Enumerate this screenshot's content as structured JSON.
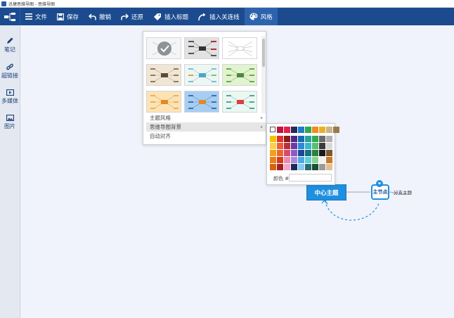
{
  "window": {
    "title": "迅捷思维导图 - 思维导图"
  },
  "toolbar": {
    "items": [
      {
        "label": "文件",
        "icon": "menu-icon"
      },
      {
        "label": "保存",
        "icon": "save-icon"
      },
      {
        "label": "撤销",
        "icon": "undo-icon"
      },
      {
        "label": "还原",
        "icon": "redo-icon"
      },
      {
        "label": "插入标题",
        "icon": "tag-icon"
      },
      {
        "label": "插入关连线",
        "icon": "relation-line-icon"
      },
      {
        "label": "风格",
        "icon": "palette-icon"
      }
    ],
    "active": "风格"
  },
  "sidebar": {
    "items": [
      {
        "label": "笔记",
        "icon": "pen-icon"
      },
      {
        "label": "超链接",
        "icon": "link-icon"
      },
      {
        "label": "多媒体",
        "icon": "media-icon"
      },
      {
        "label": "图片",
        "icon": "image-icon"
      }
    ]
  },
  "style_menu": {
    "thumbnail_count": 9,
    "selected_thumbnail": 0,
    "options": [
      {
        "label": "主题风格",
        "has_submenu": true
      },
      {
        "label": "思维导图背景",
        "has_submenu": true
      },
      {
        "label": "自动对齐",
        "has_submenu": false
      }
    ],
    "highlighted": "思维导图背景"
  },
  "color_picker": {
    "label": "颜色 #",
    "value": "",
    "top_row": [
      "#ffffff",
      "#c0143c",
      "#e81e4b",
      "#1f2d5c",
      "#1f7bd0",
      "#2fa84f",
      "#f08c1e",
      "#e8b02a",
      "#c8b48a",
      "#9a7a4a"
    ],
    "palette_rows": [
      [
        "#f5c200",
        "#e0342a",
        "#8b1a1a",
        "#4a2a8c",
        "#1a6ab0",
        "#2aa0a0",
        "#34a853",
        "#6a6a6a",
        "#b0b0b0"
      ],
      [
        "#f7d14a",
        "#f05a3a",
        "#b8303a",
        "#6a3aa8",
        "#2a8ad8",
        "#3ab8c8",
        "#58c070",
        "#3a3a3a",
        "#d8d8d8"
      ],
      [
        "#f2a01e",
        "#e86a2a",
        "#d84a6a",
        "#8a5ac8",
        "#1a4a90",
        "#1a7080",
        "#2a8040",
        "#1a1a1a",
        "#7a5a2a"
      ],
      [
        "#e8801a",
        "#d83a20",
        "#e88ab0",
        "#a88ad8",
        "#4aa8e8",
        "#5ad0d8",
        "#8ad090",
        "#f0f0f0",
        "#c8782a"
      ],
      [
        "#d86010",
        "#a02020",
        "#f0a8c8",
        "#1a2a60",
        "#8ac8f0",
        "#2a6a70",
        "#1a5030",
        "#9a9a9a",
        "#e0c090"
      ]
    ]
  },
  "mindmap": {
    "center": "中心主题",
    "main": "主节点",
    "sub": "分支主题"
  },
  "colors": {
    "toolbar_bg": "#1b4b8e",
    "accent": "#1f8fe0",
    "canvas_bg": "#f0f3fb"
  }
}
